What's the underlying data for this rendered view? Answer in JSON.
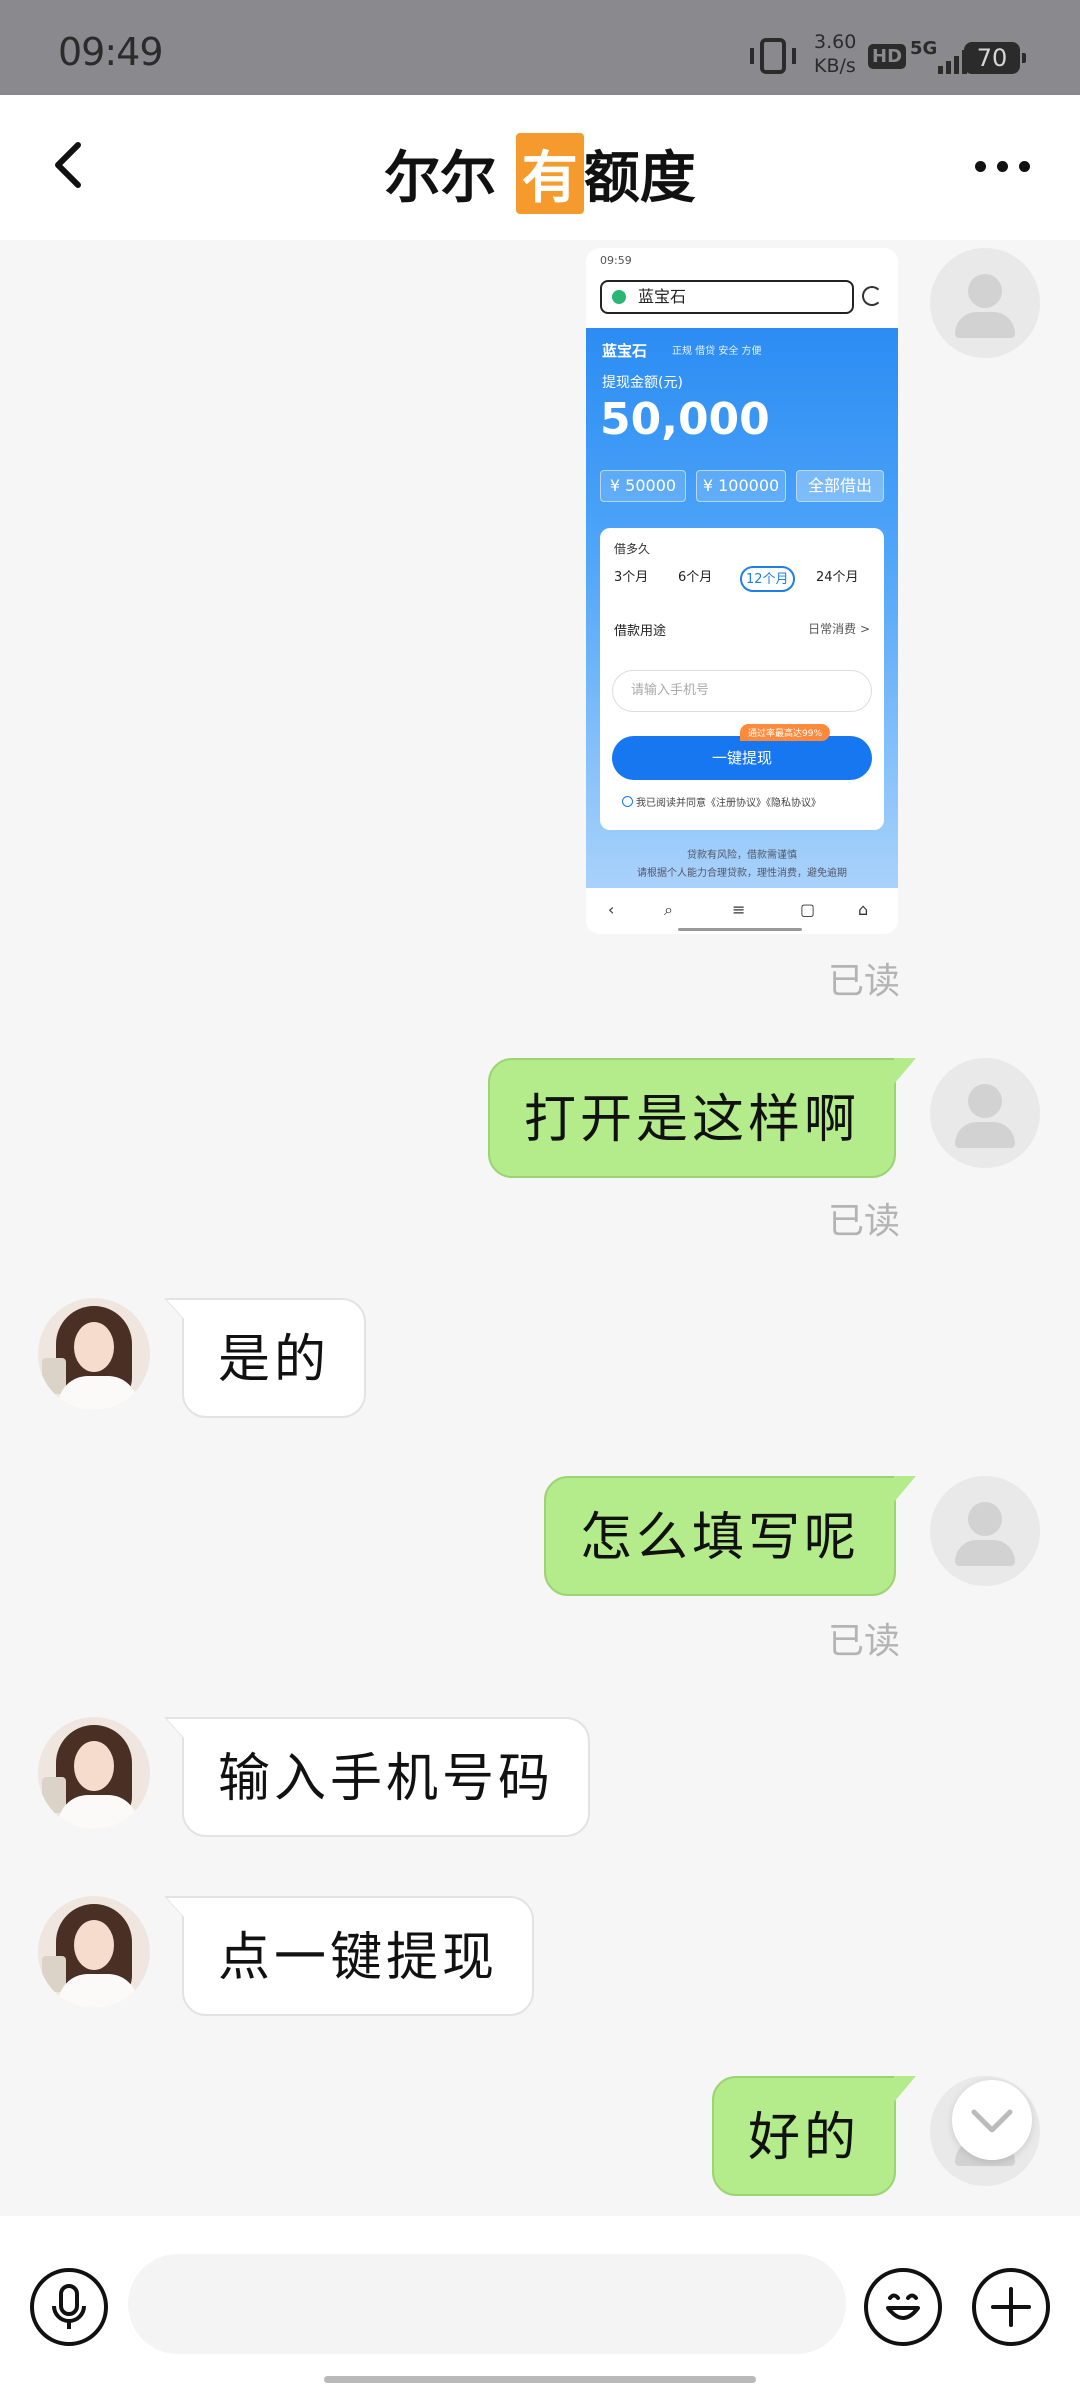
{
  "status_bar": {
    "time": "09:49",
    "speed_value": "3.60",
    "speed_unit": "KB/s",
    "hd": "HD",
    "network": "5G",
    "battery": "70"
  },
  "header": {
    "title_part1": "尔尔",
    "title_highlight": "有",
    "title_part2": "额度"
  },
  "screenshot": {
    "status_time": "09:59",
    "url_text": "蓝宝石",
    "brand": "蓝宝石",
    "tagline": "正规 借贷 安全 方便",
    "amount_label": "提现金额(元)",
    "amount": "50,000",
    "chips": [
      "¥ 50000",
      "¥ 100000",
      "全部借出"
    ],
    "term_label": "借多久",
    "terms": [
      "3个月",
      "6个月",
      "12个月",
      "24个月"
    ],
    "selected_term_index": 2,
    "purpose_label": "借款用途",
    "purpose_value": "日常消费 >",
    "phone_placeholder": "请输入手机号",
    "badge": "通过率最高达99%",
    "submit": "一键提现",
    "agreement": "我已阅读并同意《注册协议》《隐私协议》",
    "risk_line1": "贷款有风险，借款需谨慎",
    "risk_line2": "请根据个人能力合理贷款，理性消费，避免逾期"
  },
  "messages": [
    {
      "from": "me",
      "text": "打开是这样啊"
    },
    {
      "from": "her",
      "text": "是的"
    },
    {
      "from": "me",
      "text": "怎么填写呢"
    },
    {
      "from": "her",
      "text": "输入手机号码"
    },
    {
      "from": "her",
      "text": "点一键提现"
    },
    {
      "from": "me",
      "text": "好的"
    }
  ],
  "read_label": "已读",
  "colors": {
    "my_bubble": "#b4ec8c",
    "her_bubble": "#ffffff",
    "title_highlight": "#f59a2c",
    "screenshot_blue": "#2b8cf3"
  }
}
